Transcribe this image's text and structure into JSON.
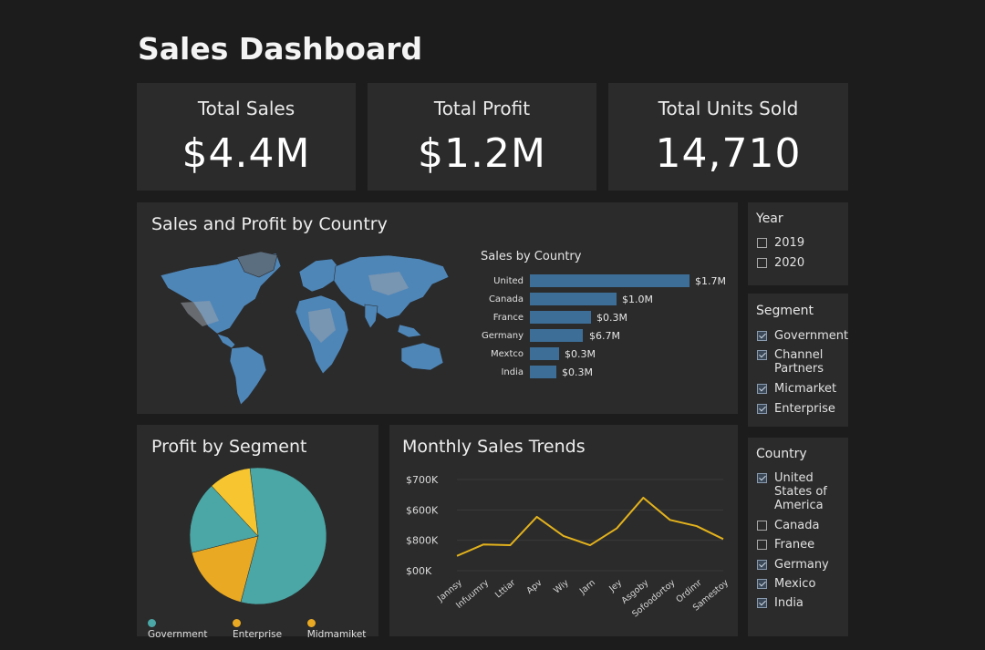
{
  "page_title": "Sales Dashboard",
  "kpis": [
    {
      "label": "Total Sales",
      "value": "$4.4M"
    },
    {
      "label": "Total Profit",
      "value": "$1.2M"
    },
    {
      "label": "Total Units Sold",
      "value": "14,710"
    }
  ],
  "map_panel": {
    "title": "Sales and Profit by Country",
    "bar_title": "Sales by Country"
  },
  "chart_data": [
    {
      "type": "bar",
      "title": "Sales by Country",
      "orientation": "horizontal",
      "categories": [
        "United",
        "Canada",
        "France",
        "Germany",
        "Mextco",
        "India"
      ],
      "values": [
        1.7,
        1.0,
        0.6,
        0.55,
        0.3,
        0.28
      ],
      "data_labels": [
        "$1.7M",
        "$1.0M",
        "$0.3M",
        "$6.7M",
        "$0.3M",
        "$0.3M"
      ],
      "color": "#3d6e98"
    },
    {
      "type": "pie",
      "title": "Profit by Segment",
      "slices": [
        {
          "name": "Government",
          "value": 56,
          "color": "#4aa7a6"
        },
        {
          "name": "Enterprise",
          "value": 17,
          "color": "#e9a923"
        },
        {
          "name": "Midmamiket",
          "value": 10,
          "color": "#f6c52f"
        }
      ],
      "extra_slice": {
        "value": 17,
        "color": "#4aa7a6"
      },
      "legend": [
        "Government",
        "Enterprise",
        "Midmamiket"
      ]
    },
    {
      "type": "line",
      "title": "Monthly Sales Trends",
      "y_tick_labels": [
        "$700K",
        "$600K",
        "$800K",
        "$00K"
      ],
      "x": [
        "Jannsy",
        "Infuumry",
        "Lttiar",
        "Apv",
        "Wiy",
        "Jarn",
        "Jey",
        "Asgoby",
        "Sofoodortoy",
        "Ordimr",
        "Samestoy"
      ],
      "values": [
        0.05,
        0.2,
        0.19,
        0.56,
        0.31,
        0.19,
        0.41,
        0.81,
        0.52,
        0.44,
        0.27
      ],
      "color": "#e3b21c",
      "grid": true
    }
  ],
  "filters": {
    "year": {
      "title": "Year",
      "items": [
        {
          "label": "2019",
          "checked": false
        },
        {
          "label": "2020",
          "checked": false
        }
      ]
    },
    "segment": {
      "title": "Segment",
      "items": [
        {
          "label": "Government",
          "checked": true
        },
        {
          "label": "Channel Partners",
          "checked": true
        },
        {
          "label": "Micmarket",
          "checked": true
        },
        {
          "label": "Enterprise",
          "checked": true
        }
      ]
    },
    "country": {
      "title": "Country",
      "items": [
        {
          "label": "United States of America",
          "checked": true
        },
        {
          "label": "Canada",
          "checked": false
        },
        {
          "label": "Franee",
          "checked": false
        },
        {
          "label": "Germany",
          "checked": true
        },
        {
          "label": "Mexico",
          "checked": true
        },
        {
          "label": "India",
          "checked": true
        }
      ]
    }
  },
  "colors": {
    "background": "#1c1c1c",
    "panel": "#2b2b2b",
    "map": "#4e86b8",
    "bar": "#3d6e98",
    "line": "#e3b21c"
  }
}
